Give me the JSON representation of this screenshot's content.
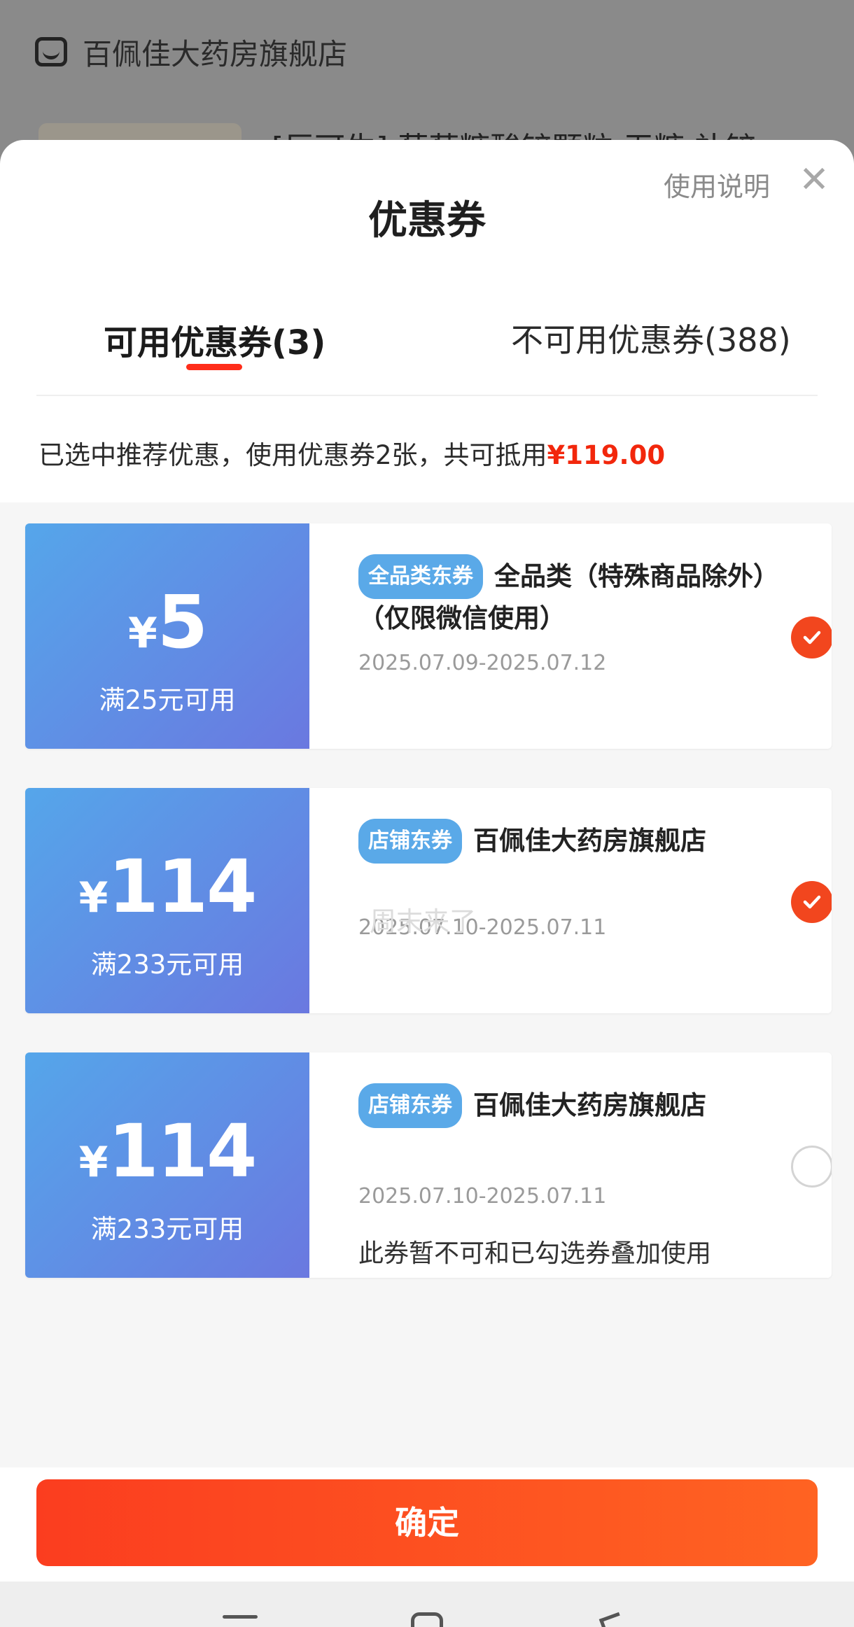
{
  "background": {
    "store_name": "百佩佳大药房旗舰店",
    "product_title": "[巨可生] 葡萄糖酸锌颗粒 无糖 补锌"
  },
  "sheet": {
    "title": "优惠券",
    "usage_link": "使用说明",
    "close_symbol": "✕"
  },
  "tabs": [
    {
      "label": "可用优惠券(3)",
      "active": true
    },
    {
      "label": "不可用优惠券(388)",
      "active": false
    }
  ],
  "summary": {
    "text": "已选中推荐优惠，使用优惠券2张，共可抵用",
    "amount": "¥119.00"
  },
  "coupons": [
    {
      "symbol": "¥",
      "amount": "5",
      "threshold": "满25元可用",
      "badge": "全品类东券",
      "title": "全品类（特殊商品除外）（仅限微信使用）",
      "validity": "2025.07.09-2025.07.12",
      "note": "",
      "selected": true
    },
    {
      "symbol": "¥",
      "amount": "114",
      "threshold": "满233元可用",
      "badge": "店铺东券",
      "title": "百佩佳大药房旗舰店",
      "validity": "2025.07.10-2025.07.11",
      "note": "",
      "selected": true
    },
    {
      "symbol": "¥",
      "amount": "114",
      "threshold": "满233元可用",
      "badge": "店铺东券",
      "title": "百佩佳大药房旗舰店",
      "validity": "2025.07.10-2025.07.11",
      "note": "此券暂不可和已勾选券叠加使用",
      "selected": false
    }
  ],
  "watermark": "周末来了",
  "confirm_label": "确定",
  "colors": {
    "accent": "#f2270c",
    "coupon_gradient_start": "#55a6ea",
    "coupon_gradient_end": "#6a78e0",
    "button_start": "#fb3d1f",
    "button_end": "#ff6322"
  }
}
